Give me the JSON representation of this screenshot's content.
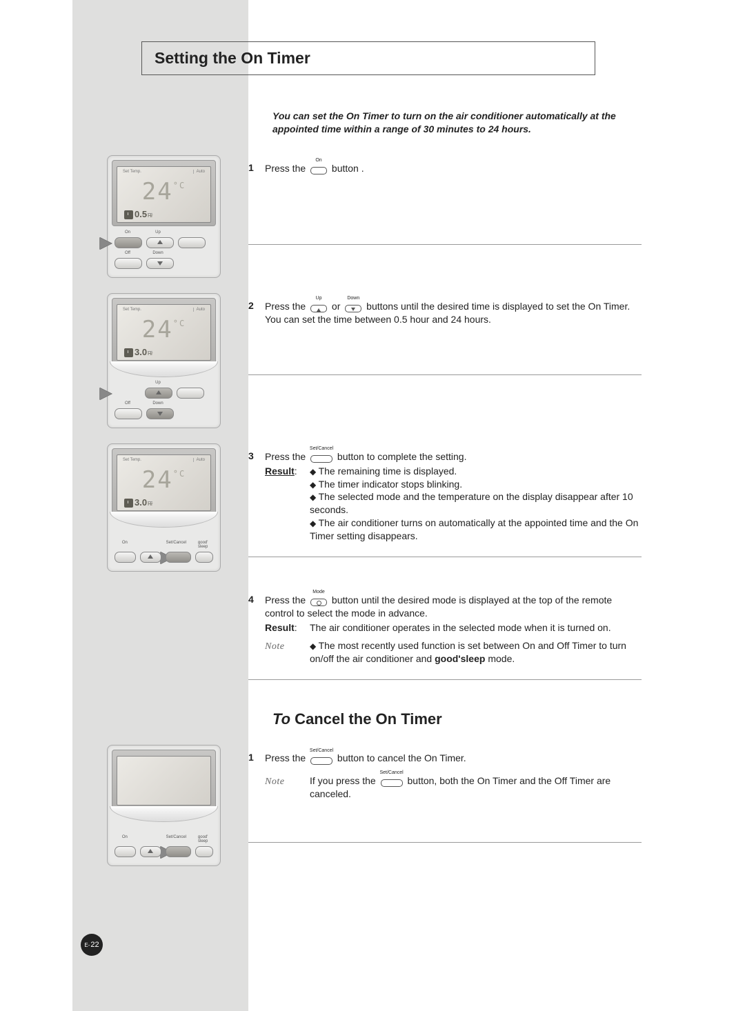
{
  "title": "Setting the On Timer",
  "intro": "You can set the On Timer to turn on the air conditioner automatically at the appointed time within a range of 30 minutes to 24 hours.",
  "steps": {
    "1": {
      "num": "1",
      "text_a": "Press the",
      "btn": "On",
      "text_b": "button ."
    },
    "2": {
      "num": "2",
      "text_a": "Press the",
      "btn1": "Up",
      "or": "or",
      "btn2": "Down",
      "text_b": "buttons until the desired time is displayed to set the On Timer. You can set the time between 0.5 hour and 24 hours."
    },
    "3": {
      "num": "3",
      "text_a": "Press the",
      "btn": "Set/Cancel",
      "text_b": "button to complete the setting.",
      "result_label": "Result",
      "result_items": [
        "The remaining time is displayed.",
        "The timer indicator stops blinking.",
        "The selected mode and the temperature on the display disappear after 10 seconds.",
        "The air conditioner turns on automatically at the appointed time and the On Timer setting disappears."
      ]
    },
    "4": {
      "num": "4",
      "text_a": "Press the",
      "btn": "Mode",
      "text_b": "button until the desired mode is displayed at the top of the remote control to select the mode in advance.",
      "result_label": "Result",
      "result_text": "The air conditioner operates in the selected mode when it is turned on.",
      "note_label": "Note",
      "note_a": "The most recently used function is set between On and Off Timer to turn on/off the air conditioner and",
      "goodsleep": "good'sleep",
      "note_b": "mode."
    }
  },
  "cancel": {
    "title_to": "To",
    "title_rest": " Cancel the On Timer",
    "step": {
      "num": "1",
      "text_a": "Press the",
      "btn": "Set/Cancel",
      "text_b": "button to cancel the On Timer.",
      "note_label": "Note",
      "note_a": "If you press the",
      "note_b": "button, both the On Timer and the Off Timer are canceled."
    }
  },
  "remote": {
    "set_temp": "Set Temp.",
    "auto": "Auto",
    "temp": "24",
    "c": "°C",
    "timer1": "0.5",
    "timer2": "3.0",
    "timer3": "3.0",
    "hr": "Hr",
    "labels": {
      "on": "On",
      "off": "Off",
      "up": "Up",
      "down": "Down",
      "set_cancel": "Set/Cancel",
      "good_sleep": "good' sleep"
    }
  },
  "page_num_prefix": "E-",
  "page_num": "22"
}
